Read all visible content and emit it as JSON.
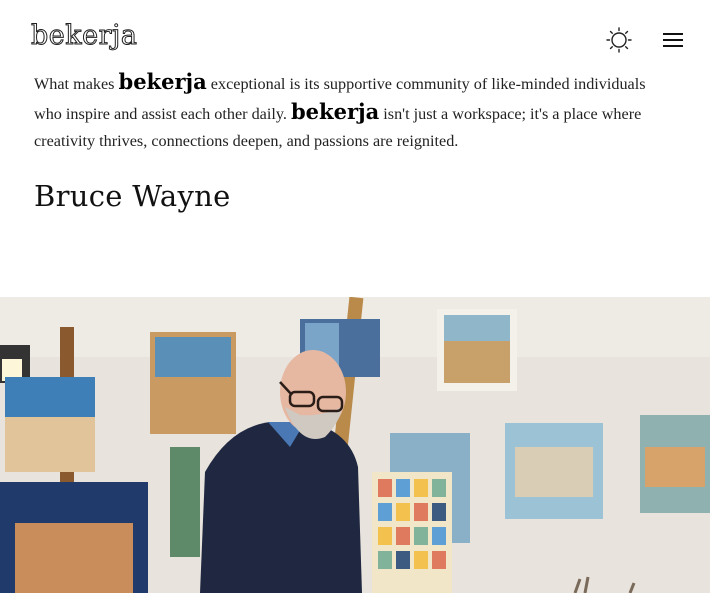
{
  "header": {
    "logo": "bekerja",
    "theme_icon": "sun-icon",
    "menu_icon": "hamburger-menu-icon"
  },
  "testimonial": {
    "text_1": "What makes ",
    "brand_1": "bekerja",
    "text_2": " exceptional is its supportive community of like-minded individuals who inspire and assist each other daily. ",
    "brand_2": "bekerja",
    "text_3": " isn't just a workspace; it's a place where creativity thrives, connections deepen, and passions are reignited.",
    "author": "Bruce Wayne"
  },
  "photo": {
    "subject": "artist-in-studio-photo"
  }
}
